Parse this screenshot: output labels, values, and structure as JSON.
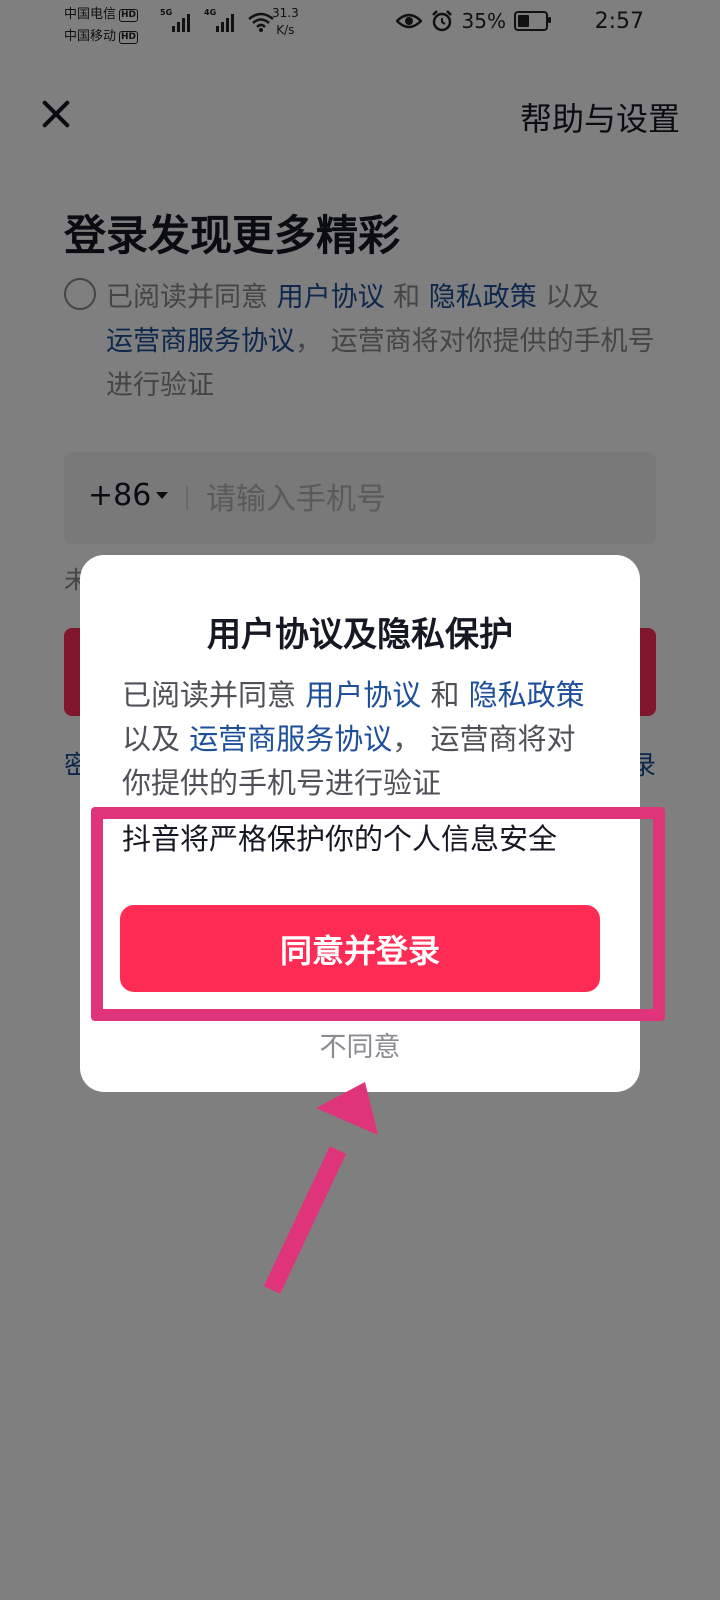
{
  "status_bar": {
    "carrier1": "中国电信",
    "carrier2": "中国移动",
    "hd_badge": "HD",
    "signal1_tag": "5G",
    "signal2_tag": "4G",
    "net_speed_value": "31.3",
    "net_speed_unit": "K/s",
    "battery": "35%",
    "time": "2:57"
  },
  "header": {
    "help_label": "帮助与设置"
  },
  "login": {
    "title": "登录发现更多精彩",
    "agree_prefix": "已阅读并同意 ",
    "user_agreement": "用户协议",
    "and": " 和 ",
    "privacy_policy": "隐私政策",
    "and_also": " 以及",
    "carrier_agreement": "运营商服务协议",
    "agree_suffix": "， 运营商将对你提供的手机号进行验证",
    "country_code": "+86",
    "phone_placeholder": "请输入手机号",
    "note_partial": "未",
    "left_link_partial": "密",
    "right_link_partial": "录"
  },
  "dialog": {
    "title": "用户协议及隐私保护",
    "text_prefix": "已阅读并同意 ",
    "user_agreement": "用户协议",
    "and": " 和 ",
    "privacy_policy": "隐私政策",
    "and_also": " 以及 ",
    "carrier_agreement": "运营商服务协议",
    "text_suffix": "， 运营商将对你提供的手机号进行验证",
    "note": "抖音将严格保护你的个人信息安全",
    "agree_button": "同意并登录",
    "disagree_button": "不同意"
  },
  "colors": {
    "primary": "#fe2c55",
    "link": "#1e4f9a",
    "annotation": "#e0347a"
  }
}
